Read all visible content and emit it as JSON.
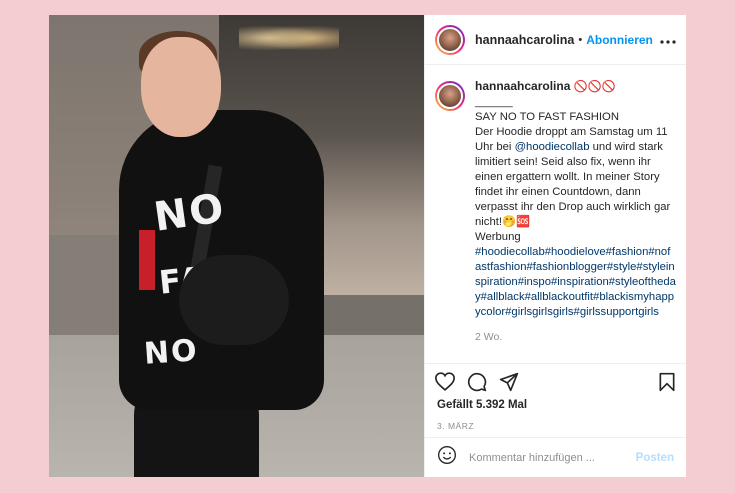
{
  "post": {
    "header": {
      "username": "hannaahcarolina",
      "separator": "•",
      "follow_label": "Abonnieren",
      "more_icon": "more-horizontal-icon"
    },
    "caption": {
      "username": "hannaahcarolina",
      "emoji": "🚫🚫🚫",
      "divider": "______",
      "line1": "SAY NO TO FAST FASHION",
      "line2_pre": "Der Hoodie droppt am Samstag um 11 Uhr bei ",
      "mention": "@hoodiecollab",
      "line2_post": " und wird stark limitiert sein! Seid also fix, wenn ihr einen ergattern wollt. In meiner Story findet ihr einen Countdown, dann verpasst ihr den Drop auch wirklich gar nicht!🤭🆘",
      "werbung": "Werbung",
      "hashtags": "#hoodiecollab#hoodielove#fashion#nofastfashion#fashionblogger#style#styleinspiration#inspo#inspiration#styleoftheday#allblack#allblackoutfit#blackismyhappycolor#girlsgirlsgirls#girlssupportgirls",
      "time_ago": "2 Wo."
    },
    "likes": "Gefällt 5.392 Mal",
    "date": "3. MÄRZ",
    "comment": {
      "placeholder": "Kommentar hinzufügen ...",
      "post_label": "Posten"
    },
    "photo_print": [
      "NO",
      "FAS",
      "NO"
    ]
  },
  "colors": {
    "background": "#f4cdd1",
    "accent": "#0095f6",
    "hashtag": "#00376b",
    "post_disabled": "#b2dffc"
  }
}
